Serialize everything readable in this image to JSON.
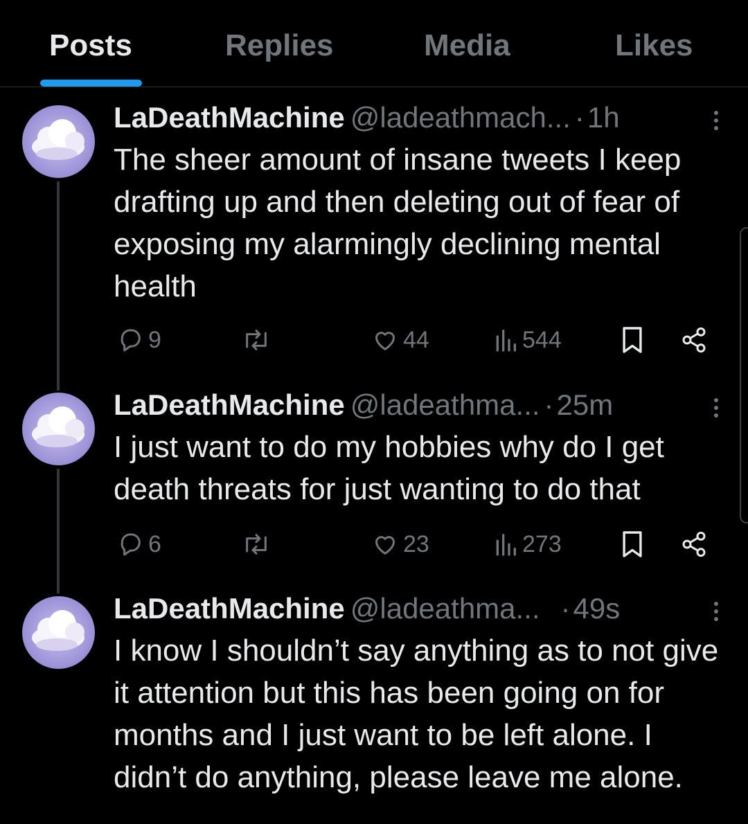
{
  "tabs": [
    {
      "label": "Posts",
      "active": true
    },
    {
      "label": "Replies",
      "active": false
    },
    {
      "label": "Media",
      "active": false
    },
    {
      "label": "Likes",
      "active": false
    }
  ],
  "colors": {
    "accent": "#1d9bf0",
    "background": "#000000",
    "text": "#e7e9ea",
    "muted": "#71767b",
    "avatar": "#9a8fd6"
  },
  "posts": [
    {
      "name": "LaDeathMachine",
      "handle": "@ladeathmach...",
      "separator": "·",
      "time": "1h",
      "text": "The sheer amount of insane tweets I keep drafting up and then deleting out of fear of exposing my alarmingly declining mental health",
      "replies": "9",
      "likes": "44",
      "views": "544"
    },
    {
      "name": "LaDeathMachine",
      "handle": "@ladeathma...",
      "separator": "·",
      "time": "25m",
      "text": "I just want to do my hobbies why do I get death threats for just wanting to do that",
      "replies": "6",
      "likes": "23",
      "views": "273"
    },
    {
      "name": "LaDeathMachine",
      "handle": "@ladeathma...",
      "separator": "·",
      "time": "49s",
      "text": "I know I shouldn’t say anything as to not give it attention but this has been going on for months and I just want to be left alone. I didn’t do anything, please leave me alone."
    }
  ],
  "icons": [
    "reply-icon",
    "repost-icon",
    "like-icon",
    "views-icon",
    "bookmark-icon",
    "share-icon",
    "more-icon"
  ]
}
